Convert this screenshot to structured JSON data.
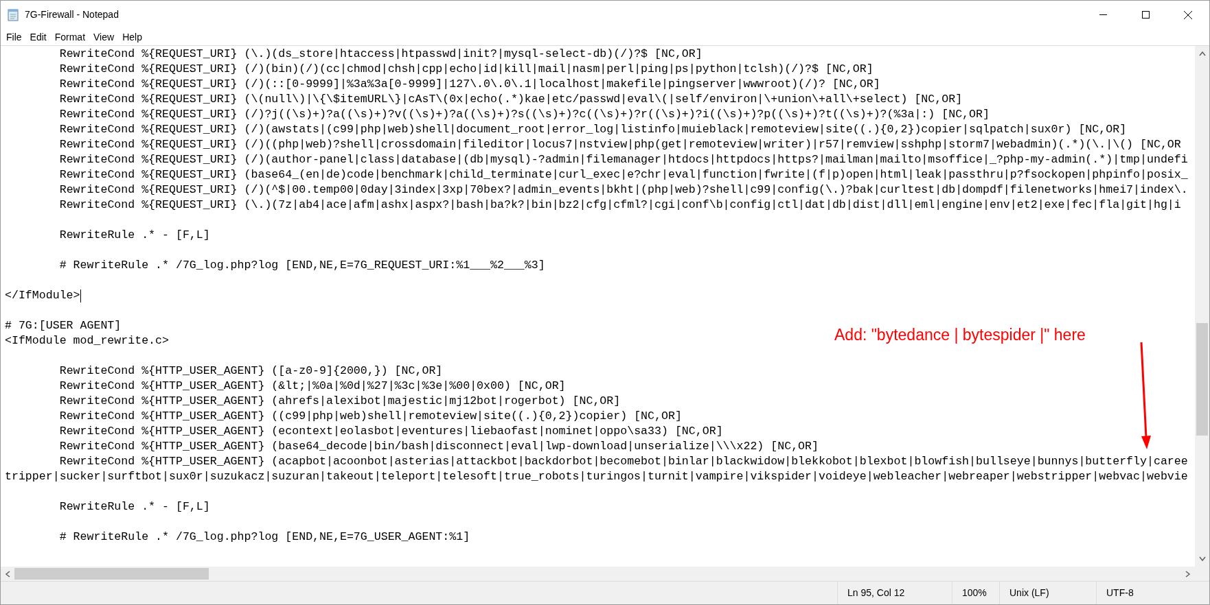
{
  "window": {
    "title": "7G-Firewall - Notepad"
  },
  "menu": [
    "File",
    "Edit",
    "Format",
    "View",
    "Help"
  ],
  "editor": {
    "lines": [
      {
        "kind": "text",
        "text": "\tRewriteCond %{REQUEST_URI} (\\.)(ds_store|htaccess|htpasswd|init?|mysql-select-db)(/)?$ [NC,OR]",
        "caret": false
      },
      {
        "kind": "text",
        "text": "\tRewriteCond %{REQUEST_URI} (/)(bin)(/)(cc|chmod|chsh|cpp|echo|id|kill|mail|nasm|perl|ping|ps|python|tclsh)(/)?$ [NC,OR]",
        "caret": false
      },
      {
        "kind": "text",
        "text": "\tRewriteCond %{REQUEST_URI} (/)(::[0-9999]|%3a%3a[0-9999]|127\\.0\\.0\\.1|localhost|makefile|pingserver|wwwroot)(/)? [NC,OR]",
        "caret": false
      },
      {
        "kind": "text",
        "text": "\tRewriteCond %{REQUEST_URI} (\\(null\\)|\\{\\$itemURL\\}|cAsT\\(0x|echo(.*)kae|etc/passwd|eval\\(|self/environ|\\+union\\+all\\+select) [NC,OR]",
        "caret": false
      },
      {
        "kind": "text",
        "text": "\tRewriteCond %{REQUEST_URI} (/)?j((\\s)+)?a((\\s)+)?v((\\s)+)?a((\\s)+)?s((\\s)+)?c((\\s)+)?r((\\s)+)?i((\\s)+)?p((\\s)+)?t((\\s)+)?(%3a|:) [NC,OR]",
        "caret": false
      },
      {
        "kind": "text",
        "text": "\tRewriteCond %{REQUEST_URI} (/)(awstats|(c99|php|web)shell|document_root|error_log|listinfo|muieblack|remoteview|site((.){0,2})copier|sqlpatch|sux0r) [NC,OR]",
        "caret": false
      },
      {
        "kind": "text",
        "text": "\tRewriteCond %{REQUEST_URI} (/)((php|web)?shell|crossdomain|fileditor|locus7|nstview|php(get|remoteview|writer)|r57|remview|sshphp|storm7|webadmin)(.*)(\\.|\\() [NC,OR",
        "caret": false
      },
      {
        "kind": "text",
        "text": "\tRewriteCond %{REQUEST_URI} (/)(author-panel|class|database|(db|mysql)-?admin|filemanager|htdocs|httpdocs|https?|mailman|mailto|msoffice|_?php-my-admin(.*)|tmp|undefi",
        "caret": false
      },
      {
        "kind": "text",
        "text": "\tRewriteCond %{REQUEST_URI} (base64_(en|de)code|benchmark|child_terminate|curl_exec|e?chr|eval|function|fwrite|(f|p)open|html|leak|passthru|p?fsockopen|phpinfo|posix_",
        "caret": false
      },
      {
        "kind": "text",
        "text": "\tRewriteCond %{REQUEST_URI} (/)(^$|00.temp00|0day|3index|3xp|70bex?|admin_events|bkht|(php|web)?shell|c99|config(\\.)?bak|curltest|db|dompdf|filenetworks|hmei7|index\\.",
        "caret": false
      },
      {
        "kind": "text",
        "text": "\tRewriteCond %{REQUEST_URI} (\\.)(7z|ab4|ace|afm|ashx|aspx?|bash|ba?k?|bin|bz2|cfg|cfml?|cgi|conf\\b|config|ctl|dat|db|dist|dll|eml|engine|env|et2|exe|fec|fla|git|hg|i",
        "caret": false
      },
      {
        "kind": "blank"
      },
      {
        "kind": "text",
        "text": "\tRewriteRule .* - [F,L]",
        "caret": false
      },
      {
        "kind": "blank"
      },
      {
        "kind": "text",
        "text": "\t# RewriteRule .* /7G_log.php?log [END,NE,E=7G_REQUEST_URI:%1___%2___%3]",
        "caret": false
      },
      {
        "kind": "blank"
      },
      {
        "kind": "text",
        "text": "</IfModule>",
        "caret": true
      },
      {
        "kind": "blank"
      },
      {
        "kind": "text",
        "text": "# 7G:[USER AGENT]",
        "caret": false
      },
      {
        "kind": "text",
        "text": "<IfModule mod_rewrite.c>",
        "caret": false
      },
      {
        "kind": "blank"
      },
      {
        "kind": "text",
        "text": "\tRewriteCond %{HTTP_USER_AGENT} ([a-z0-9]{2000,}) [NC,OR]",
        "caret": false
      },
      {
        "kind": "text",
        "text": "\tRewriteCond %{HTTP_USER_AGENT} (&lt;|%0a|%0d|%27|%3c|%3e|%00|0x00) [NC,OR]",
        "caret": false
      },
      {
        "kind": "text",
        "text": "\tRewriteCond %{HTTP_USER_AGENT} (ahrefs|alexibot|majestic|mj12bot|rogerbot) [NC,OR]",
        "caret": false
      },
      {
        "kind": "text",
        "text": "\tRewriteCond %{HTTP_USER_AGENT} ((c99|php|web)shell|remoteview|site((.){0,2})copier) [NC,OR]",
        "caret": false
      },
      {
        "kind": "text",
        "text": "\tRewriteCond %{HTTP_USER_AGENT} (econtext|eolasbot|eventures|liebaofast|nominet|oppo\\sa33) [NC,OR]",
        "caret": false
      },
      {
        "kind": "text",
        "text": "\tRewriteCond %{HTTP_USER_AGENT} (base64_decode|bin/bash|disconnect|eval|lwp-download|unserialize|\\\\\\x22) [NC,OR]",
        "caret": false
      },
      {
        "kind": "text",
        "text": "\tRewriteCond %{HTTP_USER_AGENT} (acapbot|acoonbot|asterias|attackbot|backdorbot|becomebot|binlar|blackwidow|blekkobot|blexbot|blowfish|bullseye|bunnys|butterfly|caree",
        "caret": false
      },
      {
        "kind": "text",
        "text": "tripper|sucker|surftbot|sux0r|suzukacz|suzuran|takeout|teleport|telesoft|true_robots|turingos|turnit|vampire|vikspider|voideye|webleacher|webreaper|webstripper|webvac|webvie",
        "caret": false
      },
      {
        "kind": "blank"
      },
      {
        "kind": "text",
        "text": "\tRewriteRule .* - [F,L]",
        "caret": false
      },
      {
        "kind": "blank"
      },
      {
        "kind": "text",
        "text": "\t# RewriteRule .* /7G_log.php?log [END,NE,E=7G_USER_AGENT:%1]",
        "caret": false
      }
    ]
  },
  "annotation": {
    "text": "Add: \"bytedance | bytespider |\" here"
  },
  "status_bar": [
    "Ln 95, Col 12",
    "100%",
    "Unix (LF)",
    "UTF-8"
  ]
}
